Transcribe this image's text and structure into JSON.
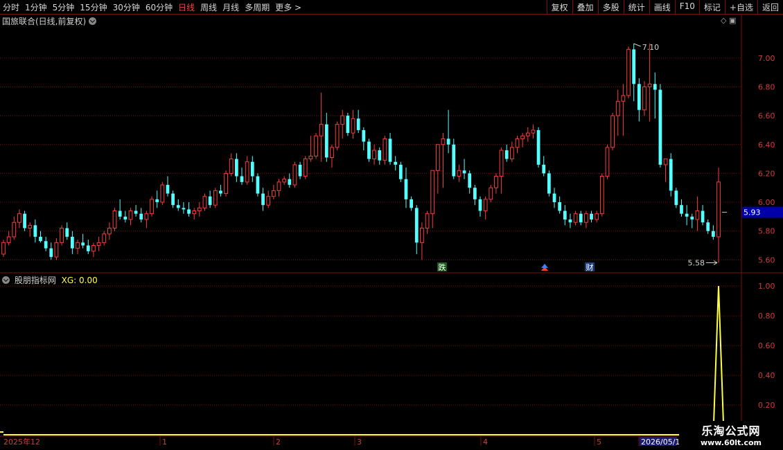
{
  "toolbar": {
    "periods": [
      "分时",
      "1分钟",
      "5分钟",
      "15分钟",
      "30分钟",
      "60分钟",
      "日线",
      "周线",
      "月线",
      "多周期",
      "更多 >"
    ],
    "active_period": "日线",
    "actions": [
      "复权",
      "叠加",
      "多股",
      "统计",
      "画线",
      "F10",
      "标记",
      "+自选",
      "返回"
    ]
  },
  "main": {
    "title": "国旅联合(日线,前复权)"
  },
  "indicator": {
    "name": "股朋指标网",
    "xg_text": "XG: 0.00"
  },
  "watermark": {
    "line1": "乐淘公式网",
    "line2": "www.60lt.com"
  },
  "colors": {
    "up": "#ff3c3c",
    "down": "#54ffff",
    "grid": "#7a1010",
    "axis_text": "#d03c3c",
    "line": "#ffff40",
    "price_box": "#0000a8"
  },
  "chart_data": [
    {
      "type": "candlestick",
      "ylim": [
        5.52,
        7.22
      ],
      "yticks": [
        "7.00",
        "6.80",
        "6.60",
        "6.40",
        "6.20",
        "6.00",
        "5.80",
        "5.60"
      ],
      "current_price": "5.93",
      "annotations": {
        "high": "7.10",
        "low": "5.58",
        "marker_1": "跌",
        "marker_2": "财"
      },
      "x_labels": [
        "2025年12",
        "1",
        "2",
        "3",
        "4",
        "5",
        "2026/05/1"
      ],
      "ohlc": [
        [
          5.64,
          5.74,
          5.62,
          5.72
        ],
        [
          5.72,
          5.8,
          5.7,
          5.76
        ],
        [
          5.76,
          5.9,
          5.74,
          5.86
        ],
        [
          5.86,
          5.95,
          5.82,
          5.92
        ],
        [
          5.92,
          5.94,
          5.8,
          5.82
        ],
        [
          5.82,
          5.86,
          5.76,
          5.84
        ],
        [
          5.84,
          5.88,
          5.72,
          5.76
        ],
        [
          5.76,
          5.8,
          5.72,
          5.73
        ],
        [
          5.73,
          5.76,
          5.66,
          5.68
        ],
        [
          5.68,
          5.72,
          5.6,
          5.62
        ],
        [
          5.62,
          5.75,
          5.6,
          5.72
        ],
        [
          5.72,
          5.84,
          5.7,
          5.82
        ],
        [
          5.82,
          5.86,
          5.74,
          5.76
        ],
        [
          5.76,
          5.8,
          5.64,
          5.68
        ],
        [
          5.68,
          5.74,
          5.64,
          5.72
        ],
        [
          5.72,
          5.78,
          5.68,
          5.7
        ],
        [
          5.7,
          5.74,
          5.64,
          5.66
        ],
        [
          5.66,
          5.72,
          5.62,
          5.7
        ],
        [
          5.7,
          5.76,
          5.66,
          5.72
        ],
        [
          5.72,
          5.8,
          5.7,
          5.78
        ],
        [
          5.78,
          5.86,
          5.74,
          5.82
        ],
        [
          5.82,
          5.96,
          5.8,
          5.94
        ],
        [
          5.94,
          6.02,
          5.88,
          5.9
        ],
        [
          5.9,
          5.94,
          5.86,
          5.88
        ],
        [
          5.88,
          5.96,
          5.84,
          5.94
        ],
        [
          5.94,
          5.98,
          5.9,
          5.92
        ],
        [
          5.92,
          5.96,
          5.86,
          5.88
        ],
        [
          5.88,
          5.94,
          5.82,
          5.92
        ],
        [
          5.92,
          6.04,
          5.9,
          6.02
        ],
        [
          6.02,
          6.08,
          5.96,
          6.0
        ],
        [
          6.0,
          6.14,
          5.98,
          6.12
        ],
        [
          6.12,
          6.18,
          6.04,
          6.06
        ],
        [
          6.06,
          6.08,
          5.96,
          5.98
        ],
        [
          5.98,
          6.02,
          5.94,
          5.96
        ],
        [
          5.96,
          6.0,
          5.92,
          5.95
        ],
        [
          5.95,
          6.0,
          5.9,
          5.92
        ],
        [
          5.92,
          5.96,
          5.88,
          5.94
        ],
        [
          5.94,
          6.0,
          5.9,
          5.96
        ],
        [
          5.96,
          6.06,
          5.94,
          6.04
        ],
        [
          6.04,
          6.08,
          5.96,
          5.98
        ],
        [
          5.98,
          6.1,
          5.96,
          6.08
        ],
        [
          6.08,
          6.12,
          6.04,
          6.06
        ],
        [
          6.06,
          6.22,
          6.04,
          6.2
        ],
        [
          6.2,
          6.34,
          6.18,
          6.3
        ],
        [
          6.3,
          6.34,
          6.14,
          6.18
        ],
        [
          6.18,
          6.24,
          6.12,
          6.14
        ],
        [
          6.14,
          6.32,
          6.12,
          6.28
        ],
        [
          6.28,
          6.32,
          6.14,
          6.18
        ],
        [
          6.18,
          6.2,
          6.04,
          6.06
        ],
        [
          6.06,
          6.1,
          5.94,
          5.98
        ],
        [
          5.98,
          6.08,
          5.96,
          6.04
        ],
        [
          6.04,
          6.12,
          6.02,
          6.08
        ],
        [
          6.08,
          6.16,
          6.04,
          6.14
        ],
        [
          6.14,
          6.18,
          6.12,
          6.16
        ],
        [
          6.16,
          6.2,
          6.1,
          6.12
        ],
        [
          6.12,
          6.28,
          6.1,
          6.26
        ],
        [
          6.26,
          6.28,
          6.16,
          6.18
        ],
        [
          6.18,
          6.32,
          6.16,
          6.3
        ],
        [
          6.3,
          6.46,
          6.28,
          6.32
        ],
        [
          6.32,
          6.48,
          6.3,
          6.46
        ],
        [
          6.46,
          6.76,
          6.28,
          6.54
        ],
        [
          6.54,
          6.62,
          6.28,
          6.31
        ],
        [
          6.31,
          6.4,
          6.24,
          6.38
        ],
        [
          6.38,
          6.56,
          6.36,
          6.54
        ],
        [
          6.54,
          6.64,
          6.44,
          6.6
        ],
        [
          6.6,
          6.62,
          6.46,
          6.48
        ],
        [
          6.48,
          6.64,
          6.44,
          6.58
        ],
        [
          6.58,
          6.64,
          6.48,
          6.5
        ],
        [
          6.5,
          6.52,
          6.36,
          6.42
        ],
        [
          6.42,
          6.44,
          6.28,
          6.3
        ],
        [
          6.3,
          6.4,
          6.26,
          6.36
        ],
        [
          6.36,
          6.38,
          6.26,
          6.29
        ],
        [
          6.29,
          6.46,
          6.26,
          6.44
        ],
        [
          6.44,
          6.48,
          6.26,
          6.28
        ],
        [
          6.28,
          6.32,
          6.22,
          6.26
        ],
        [
          6.26,
          6.28,
          6.14,
          6.16
        ],
        [
          6.16,
          6.24,
          5.96,
          6.02
        ],
        [
          6.02,
          6.04,
          5.94,
          5.96
        ],
        [
          5.96,
          5.98,
          5.64,
          5.72
        ],
        [
          5.72,
          5.86,
          5.6,
          5.82
        ],
        [
          5.82,
          5.94,
          5.78,
          5.92
        ],
        [
          5.92,
          5.94,
          5.82,
          6.22
        ],
        [
          6.22,
          6.26,
          6.06,
          6.4
        ],
        [
          6.4,
          6.48,
          6.1,
          6.44
        ],
        [
          6.44,
          6.64,
          6.34,
          6.4
        ],
        [
          6.4,
          6.44,
          6.16,
          6.18
        ],
        [
          6.18,
          6.26,
          6.14,
          6.22
        ],
        [
          6.22,
          6.3,
          6.16,
          6.2
        ],
        [
          6.2,
          6.22,
          6.06,
          6.1
        ],
        [
          6.1,
          6.12,
          5.98,
          6.02
        ],
        [
          6.02,
          6.04,
          5.9,
          5.94
        ],
        [
          5.94,
          6.04,
          5.88,
          6.02
        ],
        [
          6.02,
          6.12,
          6.0,
          6.1
        ],
        [
          6.1,
          6.2,
          6.06,
          6.18
        ],
        [
          6.18,
          6.38,
          6.06,
          6.36
        ],
        [
          6.36,
          6.4,
          6.28,
          6.3
        ],
        [
          6.3,
          6.42,
          6.28,
          6.38
        ],
        [
          6.38,
          6.46,
          6.34,
          6.44
        ],
        [
          6.44,
          6.48,
          6.38,
          6.46
        ],
        [
          6.46,
          6.52,
          6.42,
          6.48
        ],
        [
          6.48,
          6.54,
          6.44,
          6.5
        ],
        [
          6.5,
          6.52,
          6.24,
          6.26
        ],
        [
          6.26,
          6.32,
          6.18,
          6.2
        ],
        [
          6.2,
          6.22,
          6.04,
          6.06
        ],
        [
          6.06,
          6.1,
          5.96,
          6.0
        ],
        [
          6.0,
          6.04,
          5.92,
          5.94
        ],
        [
          5.94,
          5.98,
          5.84,
          5.88
        ],
        [
          5.88,
          5.92,
          5.82,
          5.86
        ],
        [
          5.86,
          5.94,
          5.84,
          5.92
        ],
        [
          5.92,
          5.94,
          5.84,
          5.86
        ],
        [
          5.86,
          5.94,
          5.82,
          5.92
        ],
        [
          5.92,
          5.94,
          5.86,
          5.88
        ],
        [
          5.88,
          5.94,
          5.86,
          5.92
        ],
        [
          5.92,
          6.2,
          5.9,
          6.18
        ],
        [
          6.18,
          6.4,
          6.16,
          6.38
        ],
        [
          6.38,
          6.62,
          6.36,
          6.6
        ],
        [
          6.6,
          6.78,
          6.46,
          6.7
        ],
        [
          6.7,
          6.82,
          6.46,
          6.74
        ],
        [
          6.74,
          7.08,
          6.72,
          7.06
        ],
        [
          7.06,
          7.1,
          6.7,
          6.82
        ],
        [
          6.82,
          6.86,
          6.56,
          6.64
        ],
        [
          6.64,
          6.84,
          6.6,
          6.8
        ],
        [
          6.8,
          7.1,
          6.56,
          6.82
        ],
        [
          6.82,
          6.9,
          6.58,
          6.78
        ],
        [
          6.78,
          6.82,
          6.24,
          6.26
        ],
        [
          6.26,
          6.3,
          6.14,
          6.3
        ],
        [
          6.3,
          6.34,
          6.04,
          6.08
        ],
        [
          6.08,
          6.1,
          5.96,
          5.98
        ],
        [
          5.98,
          6.02,
          5.9,
          5.92
        ],
        [
          5.92,
          5.98,
          5.84,
          5.9
        ],
        [
          5.9,
          5.92,
          5.82,
          5.88
        ],
        [
          5.88,
          6.04,
          5.8,
          5.94
        ],
        [
          5.94,
          5.98,
          5.84,
          5.86
        ],
        [
          5.86,
          5.88,
          5.78,
          5.8
        ],
        [
          5.8,
          5.84,
          5.74,
          5.76
        ],
        [
          5.76,
          6.24,
          5.58,
          6.14
        ]
      ]
    },
    {
      "type": "line",
      "name": "XG",
      "ylim": [
        0,
        1.08
      ],
      "yticks": [
        "1.00",
        "0.80",
        "0.60",
        "0.40",
        "0.20"
      ],
      "values_note": "",
      "values": [
        0,
        0,
        0,
        0,
        0,
        0,
        0,
        0,
        0,
        0,
        0,
        0,
        0,
        0,
        0,
        0,
        0,
        0,
        0,
        0,
        0,
        0,
        0,
        0,
        0,
        0,
        0,
        0,
        0,
        0,
        0,
        0,
        0,
        0,
        0,
        0,
        0,
        0,
        0,
        0,
        0,
        0,
        0,
        0,
        0,
        0,
        0,
        0,
        0,
        0,
        0,
        0,
        0,
        0,
        0,
        0,
        0,
        0,
        0,
        0,
        0,
        0,
        0,
        0,
        0,
        0,
        0,
        0,
        0,
        0,
        0,
        0,
        0,
        0,
        0,
        0,
        0,
        0,
        0,
        0,
        0,
        0,
        0,
        0,
        0,
        0,
        0,
        0,
        0,
        0,
        0,
        0,
        0,
        0,
        0,
        0,
        0,
        0,
        0,
        0,
        0,
        0,
        0,
        0,
        0,
        0,
        0,
        0,
        0,
        0,
        0,
        0,
        0,
        0,
        0,
        0,
        0,
        0,
        0,
        0,
        0,
        0,
        0,
        0,
        0,
        0,
        0,
        0,
        0,
        0,
        0,
        0,
        0,
        0,
        0,
        1,
        0
      ]
    }
  ]
}
